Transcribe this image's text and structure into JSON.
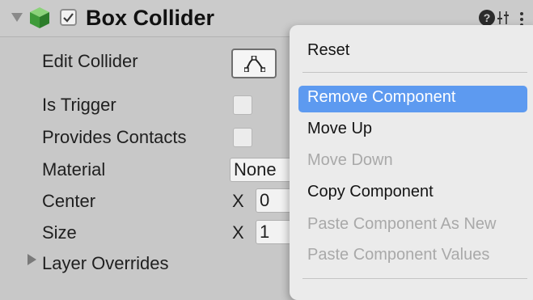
{
  "component": {
    "title": "Box Collider",
    "enabled": true
  },
  "properties": {
    "edit_collider": "Edit Collider",
    "is_trigger": "Is Trigger",
    "provides_contacts": "Provides Contacts",
    "material": "Material",
    "material_value": "None",
    "center": "Center",
    "center_x_axis": "X",
    "center_x_value": "0",
    "size": "Size",
    "size_x_axis": "X",
    "size_x_value": "1",
    "layer_overrides": "Layer Overrides"
  },
  "context_menu": {
    "items": [
      {
        "label": "Reset",
        "enabled": true
      },
      {
        "label": "Remove Component",
        "enabled": true,
        "highlighted": true
      },
      {
        "label": "Move Up",
        "enabled": true
      },
      {
        "label": "Move Down",
        "enabled": false
      },
      {
        "label": "Copy Component",
        "enabled": true
      },
      {
        "label": "Paste Component As New",
        "enabled": false
      },
      {
        "label": "Paste Component Values",
        "enabled": false
      }
    ]
  },
  "colors": {
    "highlight": "#5d9af0",
    "cube_icon": "#4caf50",
    "disabled_text": "#a9a9a9"
  }
}
